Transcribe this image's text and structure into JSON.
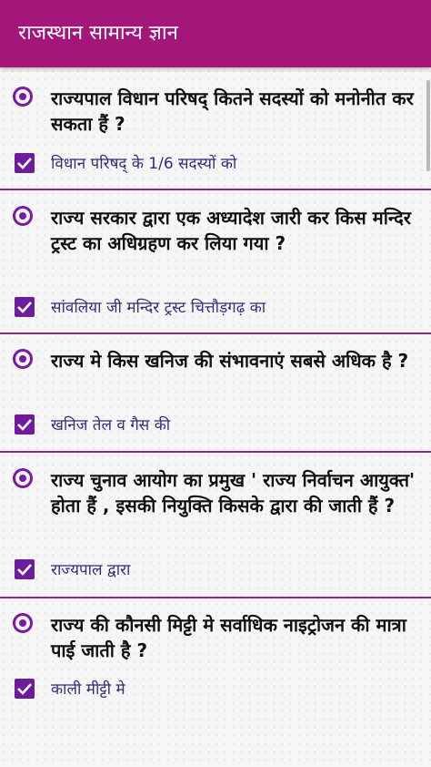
{
  "header": {
    "title": "राजस्थान सामान्य ज्ञान"
  },
  "questions": [
    {
      "question": "राज्यपाल विधान परिषद् कितने सदस्यों को मनोनीत कर सकता हैं ?",
      "answer": "विधान परिषद् के 1/6 सदस्यों को"
    },
    {
      "question": "राज्य सरकार द्वारा एक अध्यादेश जारी कर किस मन्दिर ट्रस्ट का अधिग्रहण कर लिया गया ?",
      "answer": "सांवलिया जी मन्दिर ट्रस्ट चित्तौड़गढ़ का"
    },
    {
      "question": "राज्य मे किस खनिज की संभावनाएं सबसे अधिक है ?",
      "answer": "खनिज तेल व गैस की"
    },
    {
      "question": "राज्य चुनाव आयोग का प्रमुख ' राज्य निर्वाचन आयुक्त' होता हैं , इसकी नियुक्ति किसके द्वारा की जाती हैं ?",
      "answer": "राज्यपाल द्वारा"
    },
    {
      "question": "राज्य की कौनसी मिट्टी मे सर्वाधिक नाइट्रोजन की मात्रा पाई जाती है ?",
      "answer": "काली मीट्टी मे"
    }
  ],
  "colors": {
    "appbar": "#a3167a",
    "accent": "#7a1aa0",
    "checkbox": "#6d1d9c",
    "divider": "#8e2a7a"
  }
}
